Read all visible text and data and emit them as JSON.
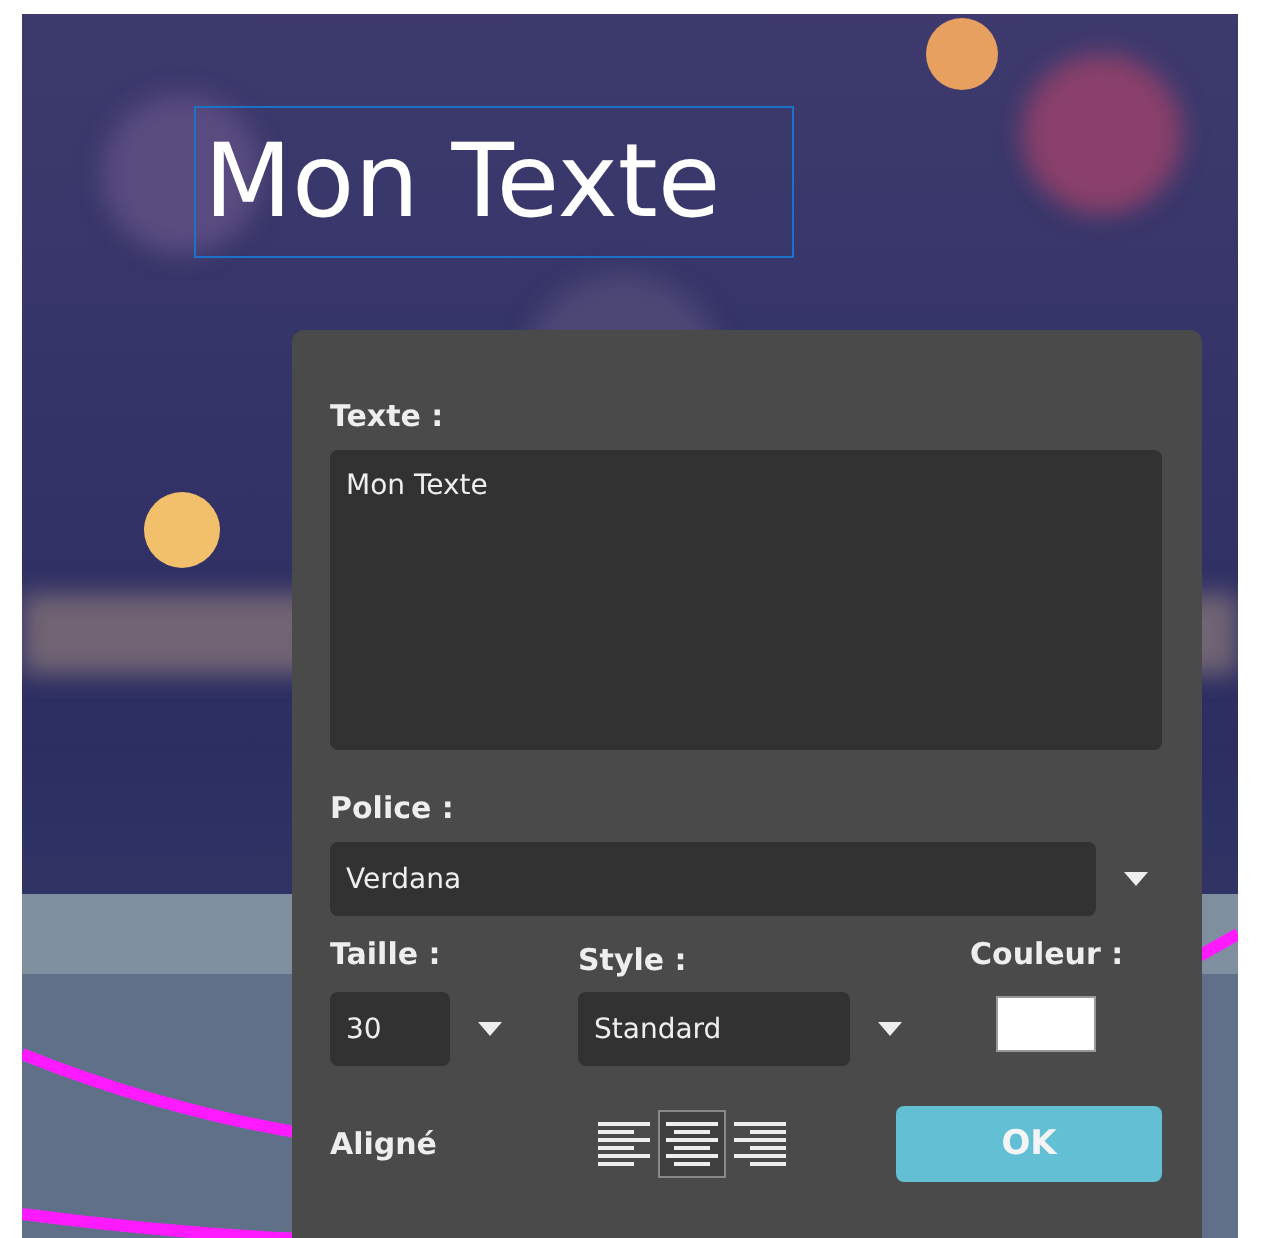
{
  "canvas": {
    "text": "Mon Texte",
    "selected": true
  },
  "panel": {
    "text_label": "Texte :",
    "text_value": "Mon Texte",
    "font_label": "Police :",
    "font_value": "Verdana",
    "size_label": "Taille :",
    "size_value": "30",
    "style_label": "Style :",
    "style_value": "Standard",
    "color_label": "Couleur :",
    "color": "#ffffff",
    "align_label": "Aligné",
    "alignments": [
      {
        "kind": "left",
        "selected": false
      },
      {
        "kind": "center",
        "selected": true
      },
      {
        "kind": "right",
        "selected": false
      }
    ],
    "ok": "OK"
  }
}
